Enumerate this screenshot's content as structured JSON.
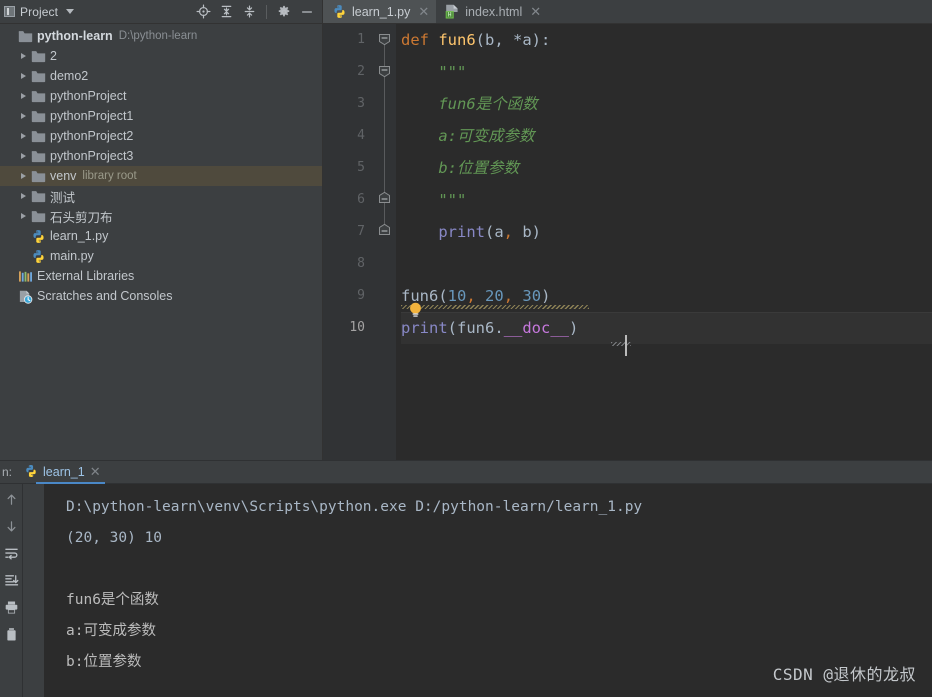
{
  "window": {
    "watermark": "CSDN @退休的龙叔"
  },
  "project_panel": {
    "title": "Project",
    "toolbar": [
      {
        "name": "locate-icon",
        "tooltip": "Select Opened File"
      },
      {
        "name": "expand-all-icon",
        "tooltip": "Expand All"
      },
      {
        "name": "collapse-all-icon",
        "tooltip": "Collapse All"
      },
      {
        "name": "gear-icon",
        "tooltip": "Options"
      },
      {
        "name": "minimize-icon",
        "tooltip": "Hide"
      }
    ],
    "tree": [
      {
        "label": "python-learn",
        "sub": "D:\\python-learn",
        "icon": "folder-icon",
        "indent": 0,
        "arrow": false,
        "bold": true,
        "selected": false
      },
      {
        "label": "2",
        "sub": "",
        "icon": "folder-icon",
        "indent": 1,
        "arrow": true,
        "bold": false,
        "selected": false
      },
      {
        "label": "demo2",
        "sub": "",
        "icon": "folder-icon",
        "indent": 1,
        "arrow": true,
        "bold": false,
        "selected": false
      },
      {
        "label": "pythonProject",
        "sub": "",
        "icon": "folder-icon",
        "indent": 1,
        "arrow": true,
        "bold": false,
        "selected": false
      },
      {
        "label": "pythonProject1",
        "sub": "",
        "icon": "folder-icon",
        "indent": 1,
        "arrow": true,
        "bold": false,
        "selected": false
      },
      {
        "label": "pythonProject2",
        "sub": "",
        "icon": "folder-icon",
        "indent": 1,
        "arrow": true,
        "bold": false,
        "selected": false
      },
      {
        "label": "pythonProject3",
        "sub": "",
        "icon": "folder-icon",
        "indent": 1,
        "arrow": true,
        "bold": false,
        "selected": false
      },
      {
        "label": "venv",
        "sub": "library root",
        "icon": "folder-icon",
        "indent": 1,
        "arrow": true,
        "bold": false,
        "selected": true
      },
      {
        "label": "测试",
        "sub": "",
        "icon": "folder-icon",
        "indent": 1,
        "arrow": true,
        "bold": false,
        "selected": false
      },
      {
        "label": "石头剪刀布",
        "sub": "",
        "icon": "folder-icon",
        "indent": 1,
        "arrow": true,
        "bold": false,
        "selected": false
      },
      {
        "label": "learn_1.py",
        "sub": "",
        "icon": "python-file-icon",
        "indent": 1,
        "arrow": false,
        "bold": false,
        "selected": false
      },
      {
        "label": "main.py",
        "sub": "",
        "icon": "python-file-icon",
        "indent": 1,
        "arrow": false,
        "bold": false,
        "selected": false
      },
      {
        "label": "External Libraries",
        "sub": "",
        "icon": "libraries-icon",
        "indent": 0,
        "arrow": false,
        "bold": false,
        "selected": false
      },
      {
        "label": "Scratches and Consoles",
        "sub": "",
        "icon": "scratches-icon",
        "indent": 0,
        "arrow": false,
        "bold": false,
        "selected": false
      }
    ]
  },
  "editor": {
    "tabs": [
      {
        "label": "learn_1.py",
        "icon": "python-file-icon",
        "active": true
      },
      {
        "label": "index.html",
        "icon": "html-file-icon",
        "active": false
      }
    ],
    "line_numbers": [
      "1",
      "2",
      "3",
      "4",
      "5",
      "6",
      "7",
      "8",
      "9",
      "10"
    ],
    "current_line": 10,
    "lines": [
      {
        "n": 1,
        "segments": [
          {
            "t": "def",
            "c": "k-kw"
          },
          {
            "t": " ",
            "c": "k-pun"
          },
          {
            "t": "fun6",
            "c": "k-fn"
          },
          {
            "t": "(b, *a):",
            "c": "k-pun"
          }
        ]
      },
      {
        "n": 2,
        "segments": [
          {
            "t": "    \"\"\"",
            "c": "k-docq"
          }
        ]
      },
      {
        "n": 3,
        "segments": [
          {
            "t": "    fun6是个函数",
            "c": "k-doc"
          }
        ]
      },
      {
        "n": 4,
        "segments": [
          {
            "t": "    a:可变成参数",
            "c": "k-doc"
          }
        ]
      },
      {
        "n": 5,
        "segments": [
          {
            "t": "    b:位置参数",
            "c": "k-doc"
          }
        ]
      },
      {
        "n": 6,
        "segments": [
          {
            "t": "    \"\"\"",
            "c": "k-docq"
          }
        ]
      },
      {
        "n": 7,
        "segments": [
          {
            "t": "    ",
            "c": "k-pun"
          },
          {
            "t": "print",
            "c": "k-builtin"
          },
          {
            "t": "(a",
            "c": "k-pun"
          },
          {
            "t": ",",
            "c": "k-comma"
          },
          {
            "t": " b)",
            "c": "k-pun"
          }
        ]
      },
      {
        "n": 8,
        "segments": [
          {
            "t": "",
            "c": "k-pun"
          }
        ]
      },
      {
        "n": 9,
        "segments": [
          {
            "t": "fun6",
            "c": "k-call"
          },
          {
            "t": "(",
            "c": "k-pun"
          },
          {
            "t": "10",
            "c": "k-num"
          },
          {
            "t": ",",
            "c": "k-comma"
          },
          {
            "t": " ",
            "c": "k-pun"
          },
          {
            "t": "20",
            "c": "k-num"
          },
          {
            "t": ",",
            "c": "k-comma"
          },
          {
            "t": " ",
            "c": "k-pun"
          },
          {
            "t": "30",
            "c": "k-num"
          },
          {
            "t": ")",
            "c": "k-pun"
          }
        ]
      },
      {
        "n": 10,
        "segments": [
          {
            "t": "print",
            "c": "k-builtin"
          },
          {
            "t": "(",
            "c": "k-pun"
          },
          {
            "t": "fun6",
            "c": "k-call"
          },
          {
            "t": ".",
            "c": "k-pun"
          },
          {
            "t": "__doc__",
            "c": "k-magenta"
          },
          {
            "t": ")",
            "c": "k-pun"
          }
        ]
      }
    ],
    "intention_bulb": "lightbulb-icon"
  },
  "run_panel": {
    "prefix_label": "n:",
    "tab_label": "learn_1",
    "tab_icon": "python-file-icon",
    "toolbar": [
      {
        "name": "up-arrow-icon",
        "tooltip": "Up the Stack Trace"
      },
      {
        "name": "down-arrow-icon",
        "tooltip": "Down the Stack Trace"
      },
      {
        "name": "soft-wrap-icon",
        "tooltip": "Soft-Wrap"
      },
      {
        "name": "scroll-to-end-icon",
        "tooltip": "Scroll to End"
      },
      {
        "name": "print-icon",
        "tooltip": "Print"
      },
      {
        "name": "trash-icon",
        "tooltip": "Clear All"
      }
    ],
    "output": [
      "D:\\python-learn\\venv\\Scripts\\python.exe D:/python-learn/learn_1.py",
      "(20, 30) 10",
      "",
      "fun6是个函数",
      "a:可变成参数",
      "b:位置参数"
    ]
  }
}
